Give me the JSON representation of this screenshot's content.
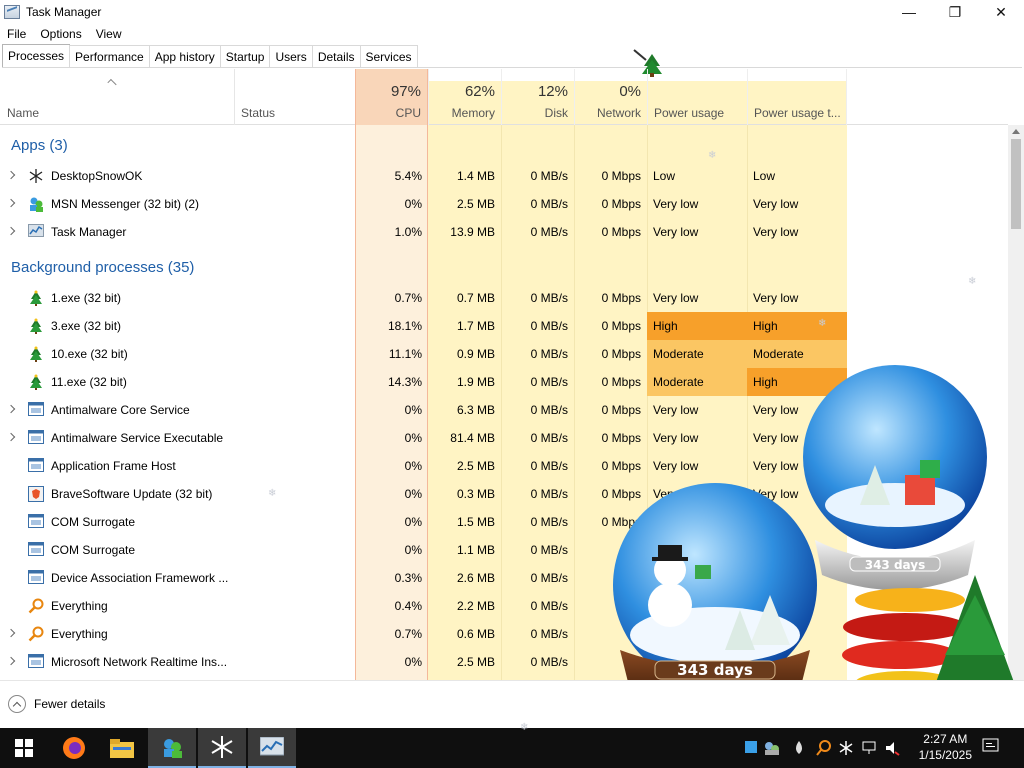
{
  "window": {
    "title": "Task Manager"
  },
  "controls": {
    "minimize": "—",
    "restore": "❐",
    "close": "✕"
  },
  "menu": [
    "File",
    "Options",
    "View"
  ],
  "tabs": [
    "Processes",
    "Performance",
    "App history",
    "Startup",
    "Users",
    "Details",
    "Services"
  ],
  "columns": {
    "name": "Name",
    "status": "Status",
    "cpu": {
      "pct": "97%",
      "label": "CPU"
    },
    "memory": {
      "pct": "62%",
      "label": "Memory"
    },
    "disk": {
      "pct": "12%",
      "label": "Disk"
    },
    "network": {
      "pct": "0%",
      "label": "Network"
    },
    "power": "Power usage",
    "power_trend": "Power usage t..."
  },
  "groups": {
    "apps": "Apps (3)",
    "background": "Background processes (35)"
  },
  "apps": [
    {
      "name": "DesktopSnowOK",
      "icon": "snowflake-icon",
      "cpu": "5.4%",
      "mem": "1.4 MB",
      "disk": "0 MB/s",
      "net": "0 Mbps",
      "power": "Low",
      "trend": "Low",
      "expand": true
    },
    {
      "name": "MSN Messenger (32 bit) (2)",
      "icon": "msn-messenger-icon",
      "cpu": "0%",
      "mem": "2.5 MB",
      "disk": "0 MB/s",
      "net": "0 Mbps",
      "power": "Very low",
      "trend": "Very low",
      "expand": true
    },
    {
      "name": "Task Manager",
      "icon": "task-manager-icon",
      "cpu": "1.0%",
      "mem": "13.9 MB",
      "disk": "0 MB/s",
      "net": "0 Mbps",
      "power": "Very low",
      "trend": "Very low",
      "expand": true
    }
  ],
  "background": [
    {
      "name": "1.exe (32 bit)",
      "icon": "tree-icon",
      "cpu": "0.7%",
      "mem": "0.7 MB",
      "disk": "0 MB/s",
      "net": "0 Mbps",
      "power": "Very low",
      "trend": "Very low",
      "expand": false
    },
    {
      "name": "3.exe (32 bit)",
      "icon": "tree-icon",
      "cpu": "18.1%",
      "mem": "1.7 MB",
      "disk": "0 MB/s",
      "net": "0 Mbps",
      "power": "High",
      "trend": "High",
      "expand": false
    },
    {
      "name": "10.exe (32 bit)",
      "icon": "tree-icon",
      "cpu": "11.1%",
      "mem": "0.9 MB",
      "disk": "0 MB/s",
      "net": "0 Mbps",
      "power": "Moderate",
      "trend": "Moderate",
      "expand": false
    },
    {
      "name": "11.exe (32 bit)",
      "icon": "tree-icon",
      "cpu": "14.3%",
      "mem": "1.9 MB",
      "disk": "0 MB/s",
      "net": "0 Mbps",
      "power": "Moderate",
      "trend": "High",
      "expand": false
    },
    {
      "name": "Antimalware Core Service",
      "icon": "service-icon",
      "cpu": "0%",
      "mem": "6.3 MB",
      "disk": "0 MB/s",
      "net": "0 Mbps",
      "power": "Very low",
      "trend": "Very low",
      "expand": true
    },
    {
      "name": "Antimalware Service Executable",
      "icon": "service-icon",
      "cpu": "0%",
      "mem": "81.4 MB",
      "disk": "0 MB/s",
      "net": "0 Mbps",
      "power": "Very low",
      "trend": "Very low",
      "expand": true
    },
    {
      "name": "Application Frame Host",
      "icon": "service-icon",
      "cpu": "0%",
      "mem": "2.5 MB",
      "disk": "0 MB/s",
      "net": "0 Mbps",
      "power": "Very low",
      "trend": "Very low",
      "expand": false
    },
    {
      "name": "BraveSoftware Update (32 bit)",
      "icon": "brave-update-icon",
      "cpu": "0%",
      "mem": "0.3 MB",
      "disk": "0 MB/s",
      "net": "0 Mbps",
      "power": "Very low",
      "trend": "Very low",
      "expand": false
    },
    {
      "name": "COM Surrogate",
      "icon": "service-icon",
      "cpu": "0%",
      "mem": "1.5 MB",
      "disk": "0 MB/s",
      "net": "0 Mbps",
      "power": "",
      "trend": "",
      "expand": false
    },
    {
      "name": "COM Surrogate",
      "icon": "service-icon",
      "cpu": "0%",
      "mem": "1.1 MB",
      "disk": "0 MB/s",
      "net": "",
      "power": "",
      "trend": "",
      "expand": false
    },
    {
      "name": "Device Association Framework ...",
      "icon": "service-icon",
      "cpu": "0.3%",
      "mem": "2.6 MB",
      "disk": "0 MB/s",
      "net": "",
      "power": "",
      "trend": "",
      "expand": false
    },
    {
      "name": "Everything",
      "icon": "search-icon",
      "cpu": "0.4%",
      "mem": "2.2 MB",
      "disk": "0 MB/s",
      "net": "",
      "power": "",
      "trend": "",
      "expand": false
    },
    {
      "name": "Everything",
      "icon": "search-icon",
      "cpu": "0.7%",
      "mem": "0.6 MB",
      "disk": "0 MB/s",
      "net": "",
      "power": "",
      "trend": "",
      "expand": true
    },
    {
      "name": "Microsoft Network Realtime Ins...",
      "icon": "service-icon",
      "cpu": "0%",
      "mem": "2.5 MB",
      "disk": "0 MB/s",
      "net": "",
      "power": "",
      "trend": "",
      "expand": true
    }
  ],
  "footer": {
    "fewer_details": "Fewer details"
  },
  "snow_globes": {
    "counter": "343 days"
  },
  "taskbar": {
    "time": "2:27 AM",
    "date": "1/15/2025"
  },
  "colors": {
    "cpu_header": "#f9d6b9",
    "cpu_bg": "#fdf0dc",
    "col_bg": "#fff4c4",
    "high": "#f7a02a",
    "moderate": "#fbc663",
    "group": "#1f5fa8"
  }
}
